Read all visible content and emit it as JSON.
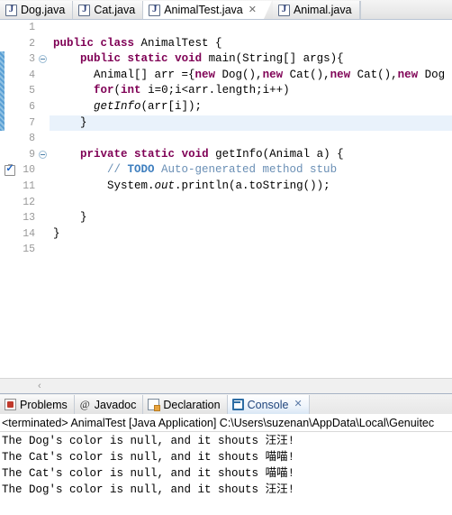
{
  "editor": {
    "tabs": [
      {
        "label": "Dog.java",
        "icon": "java-file-icon",
        "active": false,
        "closable": false
      },
      {
        "label": "Cat.java",
        "icon": "java-file-icon",
        "active": false,
        "closable": false
      },
      {
        "label": "AnimalTest.java",
        "icon": "java-file-icon",
        "active": true,
        "closable": true
      },
      {
        "label": "Animal.java",
        "icon": "java-file-icon",
        "active": false,
        "closable": false
      }
    ],
    "close_glyph": "✕",
    "current_line": 7,
    "todo_marker_line": 10,
    "change_bar_lines": [
      3,
      7
    ],
    "fold_lines": [
      3,
      9
    ],
    "line_numbers": [
      "1",
      "2",
      "3",
      "4",
      "5",
      "6",
      "7",
      "8",
      "9",
      "10",
      "11",
      "12",
      "13",
      "14",
      "15"
    ],
    "lines": [
      {
        "n": 1,
        "tokens": []
      },
      {
        "n": 2,
        "tokens": [
          {
            "t": "public",
            "c": "kw"
          },
          {
            "t": " ",
            "c": "plain"
          },
          {
            "t": "class",
            "c": "kw"
          },
          {
            "t": " AnimalTest {",
            "c": "plain"
          }
        ]
      },
      {
        "n": 3,
        "tokens": [
          {
            "t": "    ",
            "c": "plain"
          },
          {
            "t": "public",
            "c": "kw"
          },
          {
            "t": " ",
            "c": "plain"
          },
          {
            "t": "static",
            "c": "kw"
          },
          {
            "t": " ",
            "c": "plain"
          },
          {
            "t": "void",
            "c": "kw"
          },
          {
            "t": " main(String[] args){",
            "c": "plain"
          }
        ]
      },
      {
        "n": 4,
        "tokens": [
          {
            "t": "      Animal[] arr ={",
            "c": "plain"
          },
          {
            "t": "new",
            "c": "kw"
          },
          {
            "t": " Dog(),",
            "c": "plain"
          },
          {
            "t": "new",
            "c": "kw"
          },
          {
            "t": " Cat(),",
            "c": "plain"
          },
          {
            "t": "new",
            "c": "kw"
          },
          {
            "t": " Cat(),",
            "c": "plain"
          },
          {
            "t": "new",
            "c": "kw"
          },
          {
            "t": " Dog",
            "c": "plain"
          }
        ]
      },
      {
        "n": 5,
        "tokens": [
          {
            "t": "      ",
            "c": "plain"
          },
          {
            "t": "for",
            "c": "kw"
          },
          {
            "t": "(",
            "c": "plain"
          },
          {
            "t": "int",
            "c": "kw"
          },
          {
            "t": " i=0;i<arr.length;i++)",
            "c": "plain"
          }
        ]
      },
      {
        "n": 6,
        "tokens": [
          {
            "t": "      ",
            "c": "plain"
          },
          {
            "t": "getInfo",
            "c": "stat"
          },
          {
            "t": "(arr[i]);",
            "c": "plain"
          }
        ]
      },
      {
        "n": 7,
        "tokens": [
          {
            "t": "    }",
            "c": "plain"
          }
        ]
      },
      {
        "n": 8,
        "tokens": []
      },
      {
        "n": 9,
        "tokens": [
          {
            "t": "    ",
            "c": "plain"
          },
          {
            "t": "private",
            "c": "kw"
          },
          {
            "t": " ",
            "c": "plain"
          },
          {
            "t": "static",
            "c": "kw"
          },
          {
            "t": " ",
            "c": "plain"
          },
          {
            "t": "void",
            "c": "kw"
          },
          {
            "t": " getInfo(Animal a) {",
            "c": "plain"
          }
        ]
      },
      {
        "n": 10,
        "tokens": [
          {
            "t": "        // ",
            "c": "cmt"
          },
          {
            "t": "TODO",
            "c": "todo"
          },
          {
            "t": " Auto-generated method stub",
            "c": "cmt"
          }
        ]
      },
      {
        "n": 11,
        "tokens": [
          {
            "t": "        System.",
            "c": "plain"
          },
          {
            "t": "out",
            "c": "stat"
          },
          {
            "t": ".println(a.toString());",
            "c": "plain"
          }
        ]
      },
      {
        "n": 12,
        "tokens": []
      },
      {
        "n": 13,
        "tokens": [
          {
            "t": "    }",
            "c": "plain"
          }
        ]
      },
      {
        "n": 14,
        "tokens": [
          {
            "t": "}",
            "c": "plain"
          }
        ]
      },
      {
        "n": 15,
        "tokens": []
      }
    ],
    "hscroll_left_arrow": "‹"
  },
  "panel": {
    "tabs": [
      {
        "label": "Problems",
        "icon": "problems-icon",
        "active": false,
        "closable": false
      },
      {
        "label": "Javadoc",
        "icon": "javadoc-at-icon",
        "active": false,
        "closable": false
      },
      {
        "label": "Declaration",
        "icon": "declaration-icon",
        "active": false,
        "closable": false
      },
      {
        "label": "Console",
        "icon": "console-icon",
        "active": true,
        "closable": true
      }
    ],
    "javadoc_glyph": "@",
    "close_glyph": "✕",
    "console": {
      "header": "<terminated> AnimalTest [Java Application] C:\\Users\\suzenan\\AppData\\Local\\Genuitec",
      "output": [
        "The Dog's color is null, and it shouts 汪汪!",
        "The Cat's color is null, and it shouts 喵喵!",
        "The Cat's color is null, and it shouts 喵喵!",
        "The Dog's color is null, and it shouts 汪汪!"
      ]
    }
  },
  "colors": {
    "keyword": "#7f0055",
    "comment": "#6a8fb5",
    "todo": "#3f7fbf",
    "current_line_highlight": "#e9f2fb",
    "change_bar": "#5a9fd4",
    "active_panel_tab_text": "#20457c"
  }
}
